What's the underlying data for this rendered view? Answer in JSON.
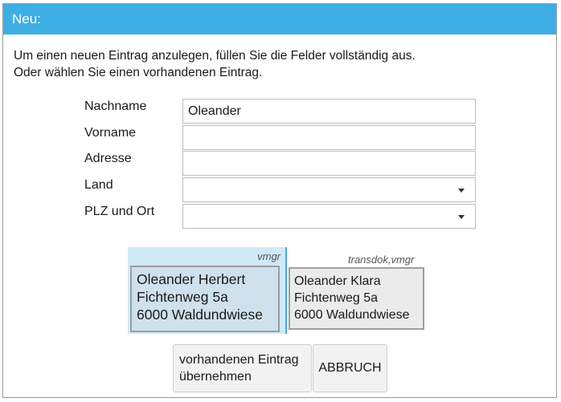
{
  "dialog": {
    "title": "Neu:",
    "intro_line1": "Um einen neuen Eintrag anzulegen, füllen Sie die Felder vollständig aus.",
    "intro_line2": "Oder wählen Sie einen vorhandenen Eintrag."
  },
  "form": {
    "nachname": {
      "label": "Nachname",
      "value": "Oleander"
    },
    "vorname": {
      "label": "Vorname",
      "value": ""
    },
    "adresse": {
      "label": "Adresse",
      "value": ""
    },
    "land": {
      "label": "Land",
      "value": ""
    },
    "plz_ort": {
      "label": "PLZ und Ort",
      "value": ""
    }
  },
  "entries": [
    {
      "tag": "vmgr",
      "line1": "Oleander Herbert",
      "line2": "Fichtenweg 5a",
      "line3": "6000 Waldundwiese",
      "selected": true
    },
    {
      "tag": "transdok,vmgr",
      "line1": "Oleander Klara",
      "line2": "Fichtenweg 5a",
      "line3": "6000 Waldundwiese",
      "selected": false
    }
  ],
  "buttons": {
    "take_line1": "vorhandenen Eintrag",
    "take_line2": "übernehmen",
    "cancel": "ABBRUCH"
  },
  "icons": {
    "dropdown": "chevron-down-icon"
  },
  "colors": {
    "accent": "#3daee3",
    "selected_bg": "#cfe9f7"
  }
}
